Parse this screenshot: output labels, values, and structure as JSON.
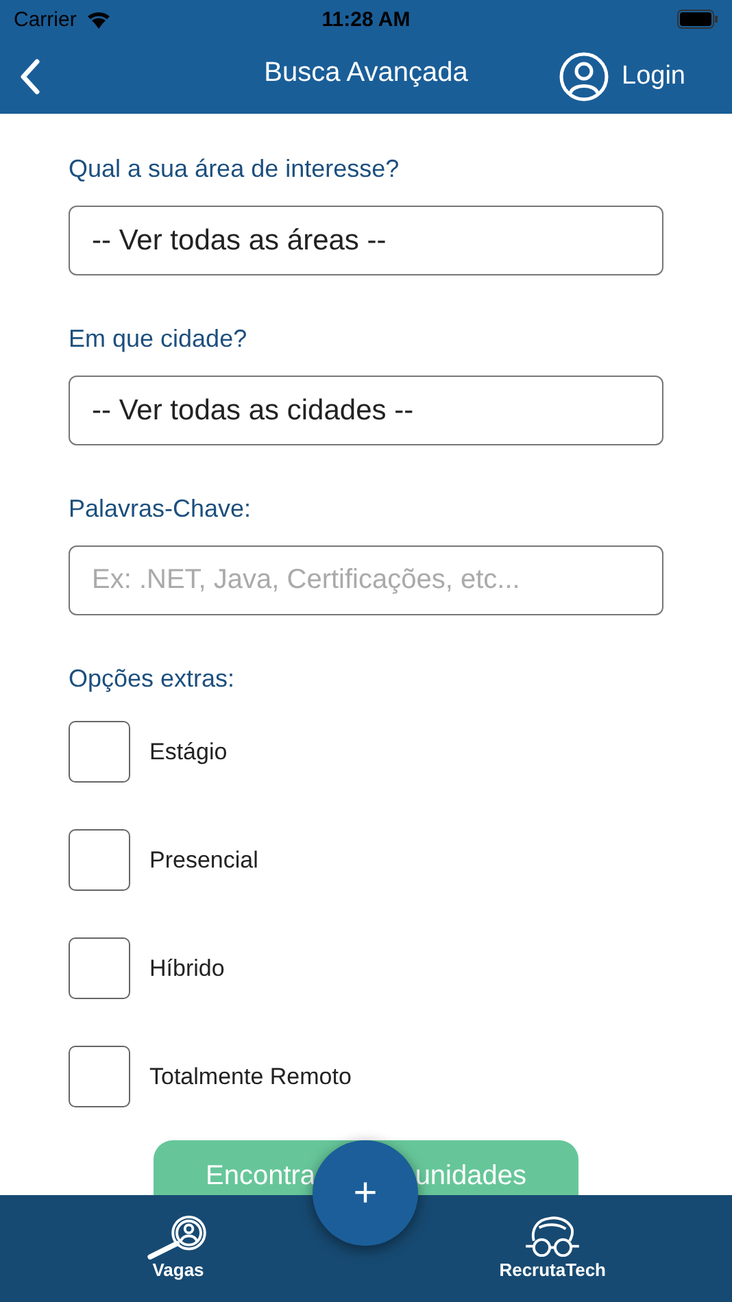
{
  "status_bar": {
    "carrier": "Carrier",
    "time": "11:28 AM"
  },
  "header": {
    "title": "Busca Avançada",
    "login": "Login"
  },
  "fields": [
    {
      "label": "Qual a sua área de interesse?",
      "value": "-- Ver todas as áreas --"
    },
    {
      "label": "Em que cidade?",
      "value": "-- Ver todas as cidades --"
    },
    {
      "label": "Palavras-Chave:",
      "placeholder": "Ex: .NET, Java, Certificações, etc..."
    }
  ],
  "options": {
    "label": "Opções extras:",
    "items": [
      {
        "label": "Estágio",
        "checked": false
      },
      {
        "label": "Presencial",
        "checked": false
      },
      {
        "label": "Híbrido",
        "checked": false
      },
      {
        "label": "Totalmente Remoto",
        "checked": false
      }
    ]
  },
  "submit_button": {
    "text_left": "Encontra",
    "text_right": "unidades"
  },
  "tab_bar": {
    "tabs": [
      {
        "label": "Vagas",
        "kind": "search"
      },
      {
        "label": "RecrutaTech",
        "kind": "mascot"
      }
    ],
    "fab": "+"
  }
}
